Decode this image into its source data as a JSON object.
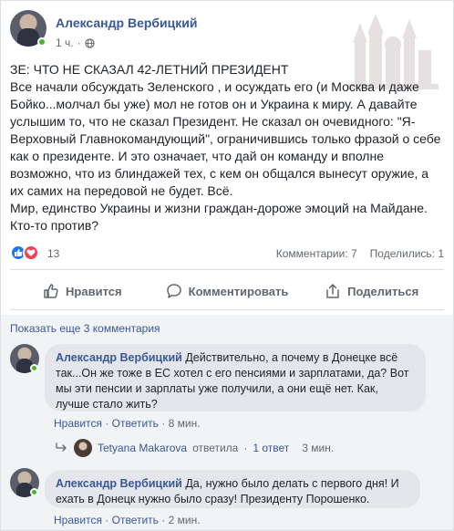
{
  "post": {
    "author": "Александр Вербицкий",
    "time": "1 ч.",
    "text_lines": [
      "ЗЕ: ЧТО НЕ СКАЗАЛ 42-ЛЕТНИЙ ПРЕЗИДЕНТ",
      "Все начали обсуждать Зеленского , и осуждать его (и Москва и даже Бойко...молчал бы уже) мол не готов он и Украина к миру. А давайте услышим то, что не сказал Президент. Не сказал он очевидного: \"Я- Верховный Главнокомандующий\", ограничившись только фразой о себе как о президенте. И это означает, что дай он команду и вполне возможно, что из блиндажей тех, с кем он общался вынесут оружие, а их самих на передовой не будет. Всё.",
      "Мир, единство Украины и жизни граждан-дороже эмоций на Майдане. Кто-то против?"
    ]
  },
  "reactions": {
    "count": "13",
    "comments": "Комментарии: 7",
    "shares": "Поделились: 1"
  },
  "actions": {
    "like": "Нравится",
    "comment": "Комментировать",
    "share": "Поделиться"
  },
  "comments": {
    "show_more": "Показать еще 3 комментария",
    "items": [
      {
        "author": "Александр Вербицкий",
        "text": "Действительно, а почему в Донецке всё так...Он же тоже в ЕС хотел с его пенсиями и зарплатами, да? Вот мы эти пенсии и зарплаты уже получили, а они ещё нет. Как, лучше стало жить?",
        "like": "Нравится",
        "reply": "Ответить",
        "time": "8 мин."
      },
      {
        "author": "Александр Вербицкий",
        "text": "Да, нужно было делать с первого дня! И ехать в Донецк нужно было сразу! Президенту Порошенко.",
        "like": "Нравится",
        "reply": "Ответить",
        "time": "2 мин."
      }
    ],
    "reply_summary": {
      "name": "Tetyana Makarova",
      "action": "ответила",
      "count": "1 ответ",
      "time": "3 мин."
    },
    "separator": "·"
  },
  "colors": {
    "link": "#385898",
    "like_blue": "#1877f2",
    "love_red": "#f33e58",
    "online_green": "#42b72a",
    "bubble": "#e4e6eb",
    "meta_gray": "#606770"
  }
}
